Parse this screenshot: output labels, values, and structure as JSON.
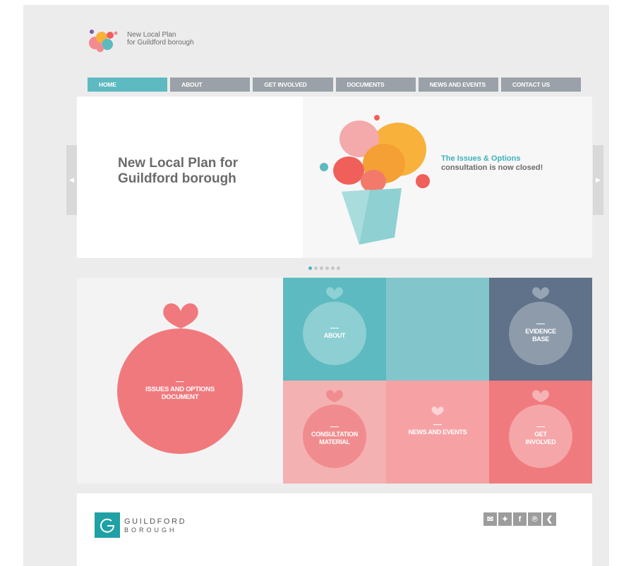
{
  "logo": {
    "line1": "New Local Plan",
    "line2": "for Guildford borough"
  },
  "nav": {
    "items": [
      {
        "label": "HOME",
        "active": true
      },
      {
        "label": "ABOUT"
      },
      {
        "label": "GET INVOLVED"
      },
      {
        "label": "DOCUMENTS"
      },
      {
        "label": "NEWS AND EVENTS"
      },
      {
        "label": "CONTACT US"
      }
    ]
  },
  "hero": {
    "title_line1": "New Local Plan for",
    "title_line2": "Guildford borough",
    "sub_line1": "The Issues & Options",
    "sub_line2": "consultation is now closed!",
    "slide_count": 6,
    "active_slide": 1
  },
  "tiles": {
    "issues": {
      "line1": "ISSUES AND OPTIONS",
      "line2": "DOCUMENT"
    },
    "about": "ABOUT",
    "evidence": {
      "line1": "EVIDENCE",
      "line2": "BASE"
    },
    "consultation": {
      "line1": "CONSULTATION",
      "line2": "MATERIAL"
    },
    "news": "NEWS AND EVENTS",
    "get_involved": {
      "line1": "GET",
      "line2": "INVOLVED"
    }
  },
  "footer": {
    "brand_line1": "GUILDFORD",
    "brand_line2": "BOROUGH",
    "social_icons": [
      "email-icon",
      "twitter-icon",
      "facebook-icon",
      "pinterest-icon",
      "share-icon"
    ]
  },
  "colors": {
    "teal": "#5dbac0",
    "slate": "#5f7289",
    "coral": "#f0797d",
    "pink": "#f4a9ab",
    "nav_grey": "#9aa1a8"
  }
}
